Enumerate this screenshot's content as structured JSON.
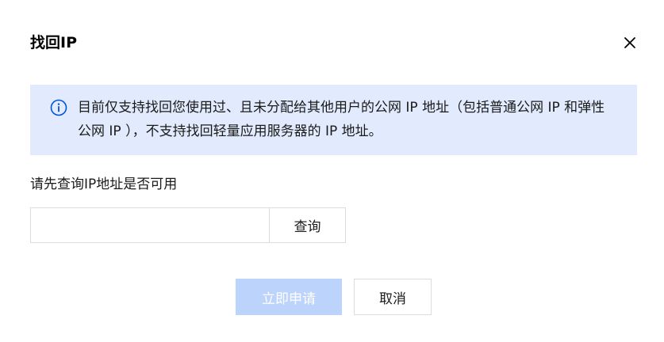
{
  "dialog": {
    "title": "找回IP",
    "close_icon": "close-icon"
  },
  "notice": {
    "icon": "info-icon",
    "text": "目前仅支持找回您使用过、且未分配给其他用户的公网 IP 地址（包括普通公网 IP 和弹性公网 IP ），不支持找回轻量应用服务器的 IP 地址。"
  },
  "query": {
    "label": "请先查询IP地址是否可用",
    "input_value": "",
    "input_placeholder": "",
    "button_label": "查询"
  },
  "footer": {
    "submit_label": "立即申请",
    "cancel_label": "取消"
  },
  "colors": {
    "notice_bg": "#e2ebfd",
    "info_icon": "#0052d9",
    "submit_disabled_bg": "#bcd3fb"
  }
}
